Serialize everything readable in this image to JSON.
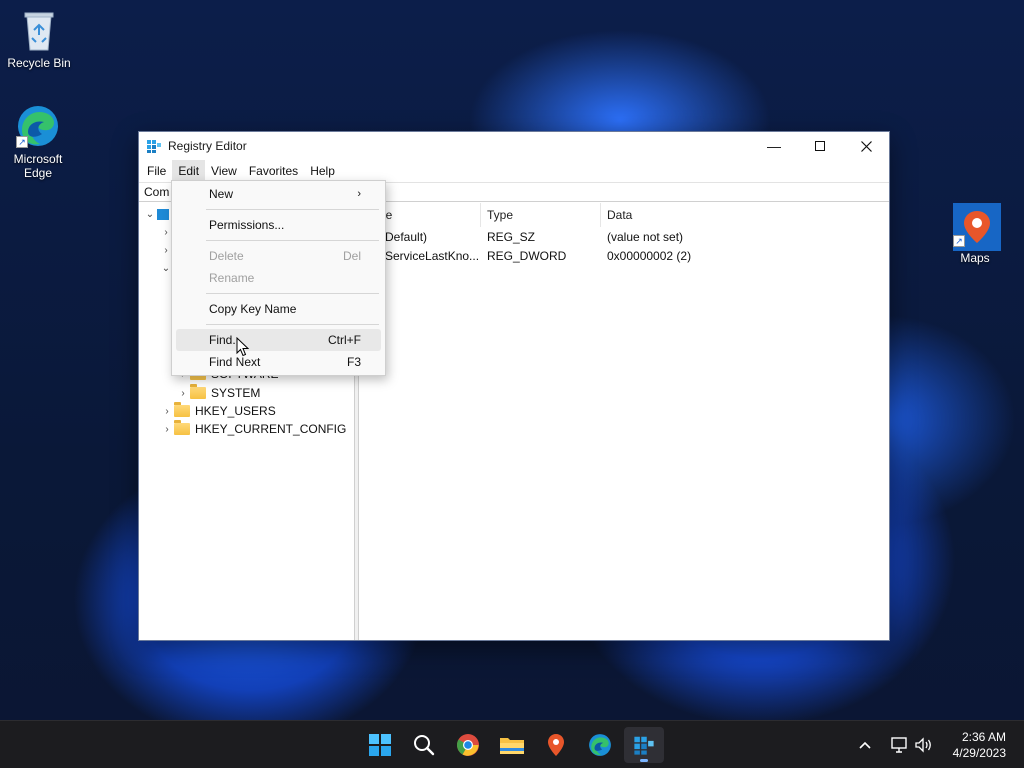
{
  "desktop": {
    "icons": [
      {
        "label": "Recycle Bin",
        "icon": "recycle-bin-icon"
      },
      {
        "label": "Microsoft Edge",
        "icon": "edge-icon"
      },
      {
        "label": "Maps",
        "icon": "maps-icon"
      }
    ]
  },
  "window": {
    "title": "Registry Editor",
    "menus": [
      "File",
      "Edit",
      "View",
      "Favorites",
      "Help"
    ],
    "active_menu": "Edit",
    "address": "Com",
    "tree": [
      {
        "label": "SOFTWARE",
        "level": 2,
        "expandable": true
      },
      {
        "label": "SYSTEM",
        "level": 2,
        "expandable": true
      },
      {
        "label": "HKEY_USERS",
        "level": 1,
        "expandable": true
      },
      {
        "label": "HKEY_CURRENT_CONFIG",
        "level": 1,
        "expandable": true
      }
    ],
    "columns": [
      "Name",
      "Type",
      "Data"
    ],
    "columns_visible": [
      "ne",
      "Type",
      "Data"
    ],
    "values": [
      {
        "name": "(Default)",
        "name_visible": "Default)",
        "type": "REG_SZ",
        "data": "(value not set)"
      },
      {
        "name": "ServiceLastKno...",
        "name_visible": "ServiceLastKno...",
        "type": "REG_DWORD",
        "data": "0x00000002 (2)"
      }
    ]
  },
  "edit_menu": {
    "items": [
      {
        "label": "New",
        "shortcut": "",
        "submenu": true,
        "disabled": false
      },
      {
        "label": "Permissions...",
        "shortcut": "",
        "submenu": false,
        "disabled": false
      },
      {
        "label": "Delete",
        "shortcut": "Del",
        "submenu": false,
        "disabled": true
      },
      {
        "label": "Rename",
        "shortcut": "",
        "submenu": false,
        "disabled": true
      },
      {
        "label": "Copy Key Name",
        "shortcut": "",
        "submenu": false,
        "disabled": false
      },
      {
        "label": "Find...",
        "shortcut": "Ctrl+F",
        "submenu": false,
        "disabled": false,
        "hovered": true
      },
      {
        "label": "Find Next",
        "shortcut": "F3",
        "submenu": false,
        "disabled": false
      }
    ]
  },
  "taskbar": {
    "apps": [
      "start-icon",
      "search-icon",
      "chrome-icon",
      "file-explorer-icon",
      "maps-icon",
      "edge-icon",
      "registry-editor-icon"
    ],
    "active_app": "registry-editor-icon",
    "clock": {
      "time": "2:36 AM",
      "date": "4/29/2023"
    }
  },
  "colors": {
    "accent": "#0067c0",
    "folder": "#f6c143",
    "taskbar": "#1c1c1f"
  }
}
